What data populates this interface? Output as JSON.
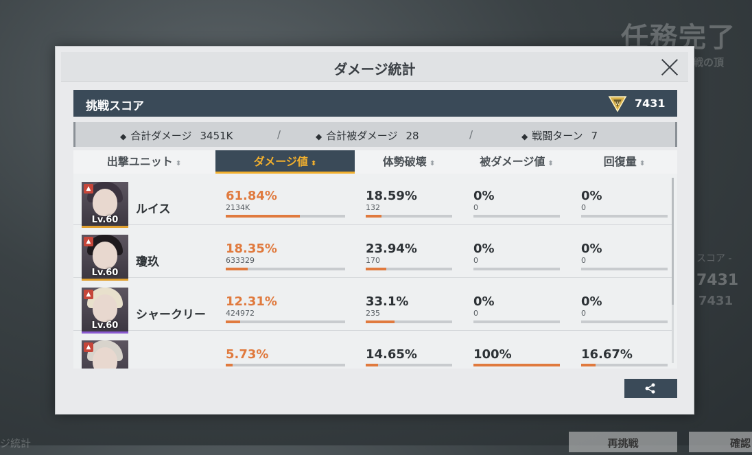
{
  "background": {
    "title": "任務完了",
    "subtitle": "戦の頂",
    "score_label": "スコア -",
    "score_big": "7431",
    "score_small": "7431",
    "left_text": "ジ統計",
    "button_retry": "再挑戦",
    "button_confirm": "確認"
  },
  "modal": {
    "title": "ダメージ統計",
    "close_icon": "close-icon"
  },
  "score": {
    "label": "挑戦スコア",
    "icon": "rank-emblem-icon",
    "value": "7431"
  },
  "summary": {
    "total_damage_label": "合計ダメージ",
    "total_damage_value": "3451K",
    "damage_taken_label": "合計被ダメージ",
    "damage_taken_value": "28",
    "turns_label": "戦闘ターン",
    "turns_value": "7",
    "separator": "/"
  },
  "tabs": [
    {
      "label": "出撃ユニット",
      "active": false
    },
    {
      "label": "ダメージ値",
      "active": true
    },
    {
      "label": "体勢破壊",
      "active": false
    },
    {
      "label": "被ダメージ値",
      "active": false
    },
    {
      "label": "回復量",
      "active": false
    }
  ],
  "colors": {
    "accent": "#f2b02e",
    "highlight": "#e07a3e",
    "panel": "#3a4a58"
  },
  "units": [
    {
      "name": "ルイス",
      "level": "Lv.60",
      "stripe": "#e0a030",
      "hair": "#3c3440",
      "damage_pct": "61.84%",
      "damage_raw": "2134K",
      "damage_ratio": 0.6184,
      "break_pct": "18.59%",
      "break_raw": "132",
      "break_ratio": 0.1859,
      "taken_pct": "0%",
      "taken_raw": "0",
      "taken_ratio": 0,
      "heal_pct": "0%",
      "heal_raw": "0",
      "heal_ratio": 0
    },
    {
      "name": "瓊玖",
      "level": "Lv.60",
      "stripe": "#e0a030",
      "hair": "#1e1a1e",
      "damage_pct": "18.35%",
      "damage_raw": "633329",
      "damage_ratio": 0.1835,
      "break_pct": "23.94%",
      "break_raw": "170",
      "break_ratio": 0.2394,
      "taken_pct": "0%",
      "taken_raw": "0",
      "taken_ratio": 0,
      "heal_pct": "0%",
      "heal_raw": "0",
      "heal_ratio": 0
    },
    {
      "name": "シャークリー",
      "level": "Lv.60",
      "stripe": "#8a5ad0",
      "hair": "#e8e0cc",
      "damage_pct": "12.31%",
      "damage_raw": "424972",
      "damage_ratio": 0.1231,
      "break_pct": "33.1%",
      "break_raw": "235",
      "break_ratio": 0.331,
      "taken_pct": "0%",
      "taken_raw": "0",
      "taken_ratio": 0,
      "heal_pct": "0%",
      "heal_raw": "0",
      "heal_ratio": 0
    },
    {
      "name": "",
      "level": "",
      "stripe": "#8a5ad0",
      "hair": "#d8d4cc",
      "damage_pct": "5.73%",
      "damage_raw": "",
      "damage_ratio": 0.0573,
      "break_pct": "14.65%",
      "break_raw": "",
      "break_ratio": 0.1465,
      "taken_pct": "100%",
      "taken_raw": "",
      "taken_ratio": 1,
      "heal_pct": "16.67%",
      "heal_raw": "",
      "heal_ratio": 0.1667
    }
  ],
  "share": {
    "icon": "share-icon"
  }
}
